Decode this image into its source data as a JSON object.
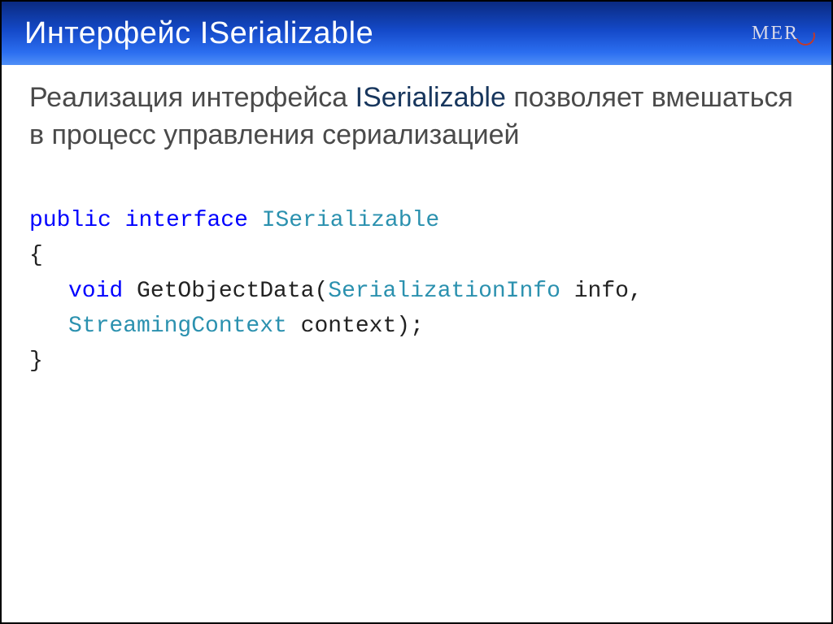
{
  "header": {
    "title": "Интерфейс ISerializable",
    "logo_text": "MER"
  },
  "intro": {
    "part1": "Реализация интерфейса ",
    "iface": "ISerializable",
    "part2": " позволяет вмешаться в процесс управления сериализацией"
  },
  "code": {
    "kw_public": "public",
    "kw_interface": "interface",
    "type_iserializable": "ISerializable",
    "brace_open": "{",
    "kw_void": "void",
    "method_sig_part1": " GetObjectData(",
    "type_serinfo": "SerializationInfo",
    "method_sig_part2": " info,",
    "type_streamctx": "StreamingContext",
    "method_sig_part3": " context);",
    "brace_close": "}"
  }
}
